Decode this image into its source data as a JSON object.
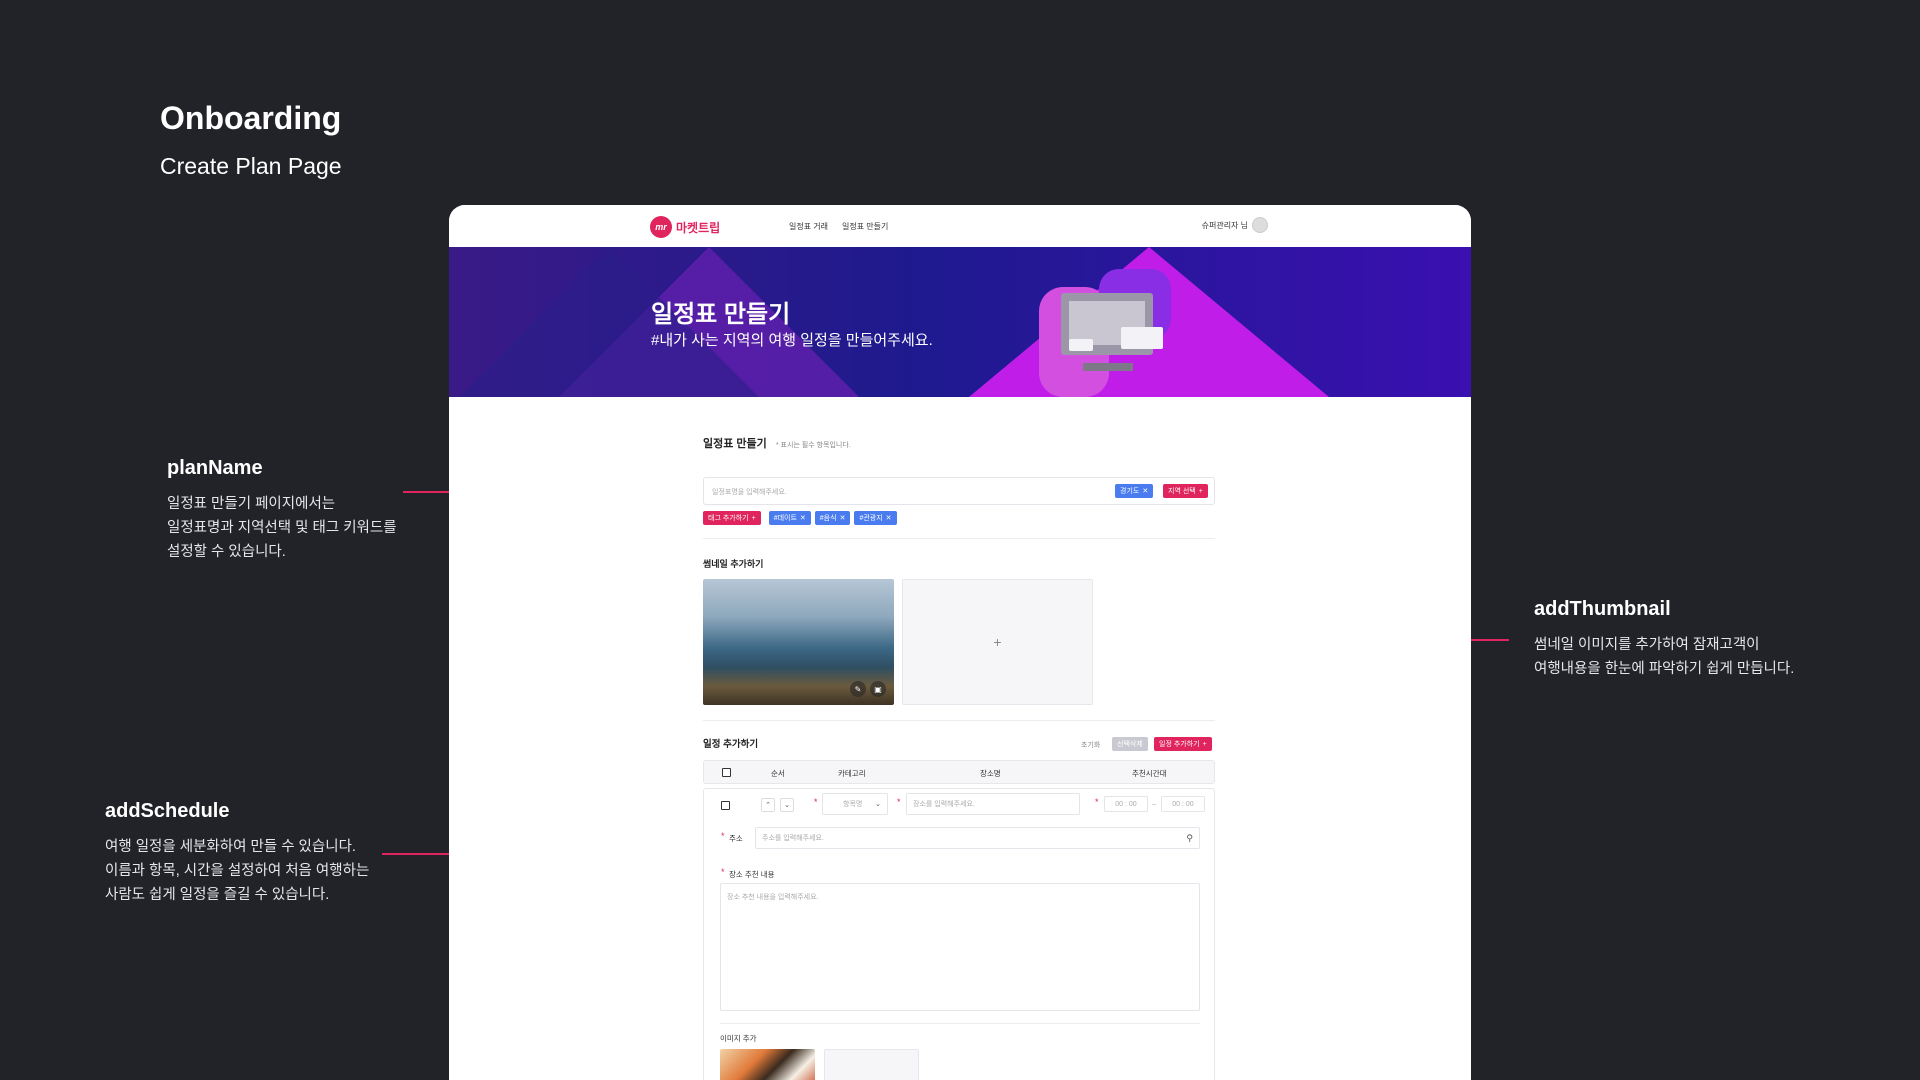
{
  "page": {
    "title": "Onboarding",
    "subtitle": "Create Plan Page"
  },
  "annotations": {
    "plan_name": {
      "title": "planName",
      "desc": "일정표 만들기 페이지에서는\n일정표명과 지역선택 및 태그 키워드를\n설정할 수 있습니다."
    },
    "add_thumbnail": {
      "title": "addThumbnail",
      "desc": "썸네일 이미지를 추가하여 잠재고객이\n여행내용을 한눈에 파악하기 쉽게 만듭니다."
    },
    "add_schedule": {
      "title": "addSchedule",
      "desc": "여행 일정을 세분화하여 만들 수 있습니다.\n이름과 항목, 시간을 설정하여 처음 여행하는\n사람도 쉽게 일정을 즐길 수 있습니다."
    }
  },
  "colors": {
    "background": "#222329",
    "accent": "#e0245e",
    "chip_blue": "#4a7cf0"
  },
  "app": {
    "logo_badge": "mr",
    "logo_text": "마켓트립",
    "nav": [
      "일정표 거래",
      "일정표 만들기"
    ],
    "user": "슈퍼관리자 님",
    "hero": {
      "title": "일정표 만들기",
      "subtitle": "#내가 사는 지역의 여행 일정을 만들어주세요."
    },
    "form": {
      "section_title": "일정표 만들기",
      "required_note": "* 표시는 필수 항목입니다.",
      "name_placeholder": "일정표명을 입력해주세요.",
      "region_chip": "경기도",
      "region_button": "지역 선택",
      "tag_button": "태그 추가하기",
      "tags": [
        "#데이트",
        "#음식",
        "#관광지"
      ]
    },
    "thumbnail": {
      "title": "썸네일 추가하기",
      "add": "+"
    },
    "schedule": {
      "title": "일정 추가하기",
      "reset": "초기화",
      "delete_selected": "선택삭제",
      "add_button": "일정 추가하기",
      "columns": [
        "순서",
        "카테고리",
        "장소명",
        "추천시간대"
      ],
      "category_placeholder": "항목명",
      "place_placeholder": "장소를 입력해주세요.",
      "time_start": "00 : 00",
      "time_sep": "~",
      "time_end": "00 : 00",
      "address_label": "주소",
      "address_placeholder": "주소를 입력해주세요.",
      "desc_label": "장소 추천 내용",
      "desc_placeholder": "장소 추천 내용을 입력해주세요.",
      "image_label": "이미지 추가"
    }
  }
}
